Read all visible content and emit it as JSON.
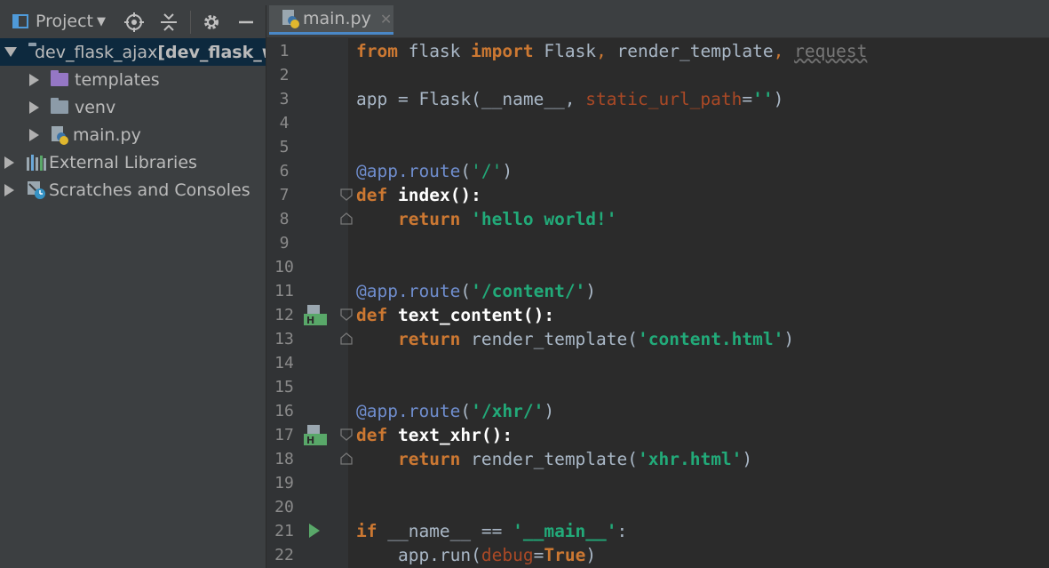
{
  "project_panel": {
    "title": "Project",
    "tree": [
      {
        "label": "dev_flask_ajax",
        "suffix": " [dev_flask_wo",
        "expanded": true,
        "icon": "folder-icon"
      },
      {
        "label": "templates",
        "icon": "folder-purple-icon"
      },
      {
        "label": "venv",
        "icon": "folder-venv-icon"
      },
      {
        "label": "main.py",
        "icon": "python-file-icon"
      },
      {
        "label": "External Libraries",
        "icon": "library-icon"
      },
      {
        "label": "Scratches and Consoles",
        "icon": "scratches-icon"
      }
    ]
  },
  "editor": {
    "tab_label": "main.py",
    "line_numbers": [
      "1",
      "2",
      "3",
      "4",
      "5",
      "6",
      "7",
      "8",
      "9",
      "10",
      "11",
      "12",
      "13",
      "14",
      "15",
      "16",
      "17",
      "18",
      "19",
      "20",
      "21",
      "22"
    ],
    "code": {
      "l1": {
        "t1": "from",
        "t2": " flask ",
        "t3": "import",
        "t4": " Flask",
        "t5": ", ",
        "t6": "render_template",
        "t7": ", ",
        "t8": "request"
      },
      "l3": {
        "t1": "app = Flask(__name__, ",
        "t2": "static_url_path",
        "t3": "=",
        "t4": "''",
        "t5": ")"
      },
      "l6": {
        "t1": "@app.route",
        "t2": "(",
        "t3": "'/'",
        "t4": ")"
      },
      "l7": {
        "t1": "def",
        "t2": " ",
        "t3": "index",
        "t4": "():"
      },
      "l8": {
        "t1": "    ",
        "t2": "return",
        "t3": " ",
        "t4": "'hello world!'"
      },
      "l11": {
        "t1": "@app.route",
        "t2": "(",
        "t3": "'/content/'",
        "t4": ")"
      },
      "l12": {
        "t1": "def",
        "t2": " ",
        "t3": "text_content",
        "t4": "():"
      },
      "l13": {
        "t1": "    ",
        "t2": "return",
        "t3": " render_template(",
        "t4": "'content.html'",
        "t5": ")"
      },
      "l16": {
        "t1": "@app.route",
        "t2": "(",
        "t3": "'/xhr/'",
        "t4": ")"
      },
      "l17": {
        "t1": "def",
        "t2": " ",
        "t3": "text_xhr",
        "t4": "():"
      },
      "l18": {
        "t1": "    ",
        "t2": "return",
        "t3": " render_template(",
        "t4": "'xhr.html'",
        "t5": ")"
      },
      "l21": {
        "t1": "if",
        "t2": " __name__ == ",
        "t3": "'__main__'",
        "t4": ":"
      },
      "l22": {
        "t1": "    app.run(",
        "t2": "debug",
        "t3": "=",
        "t4": "True",
        "t5": ")"
      }
    }
  }
}
